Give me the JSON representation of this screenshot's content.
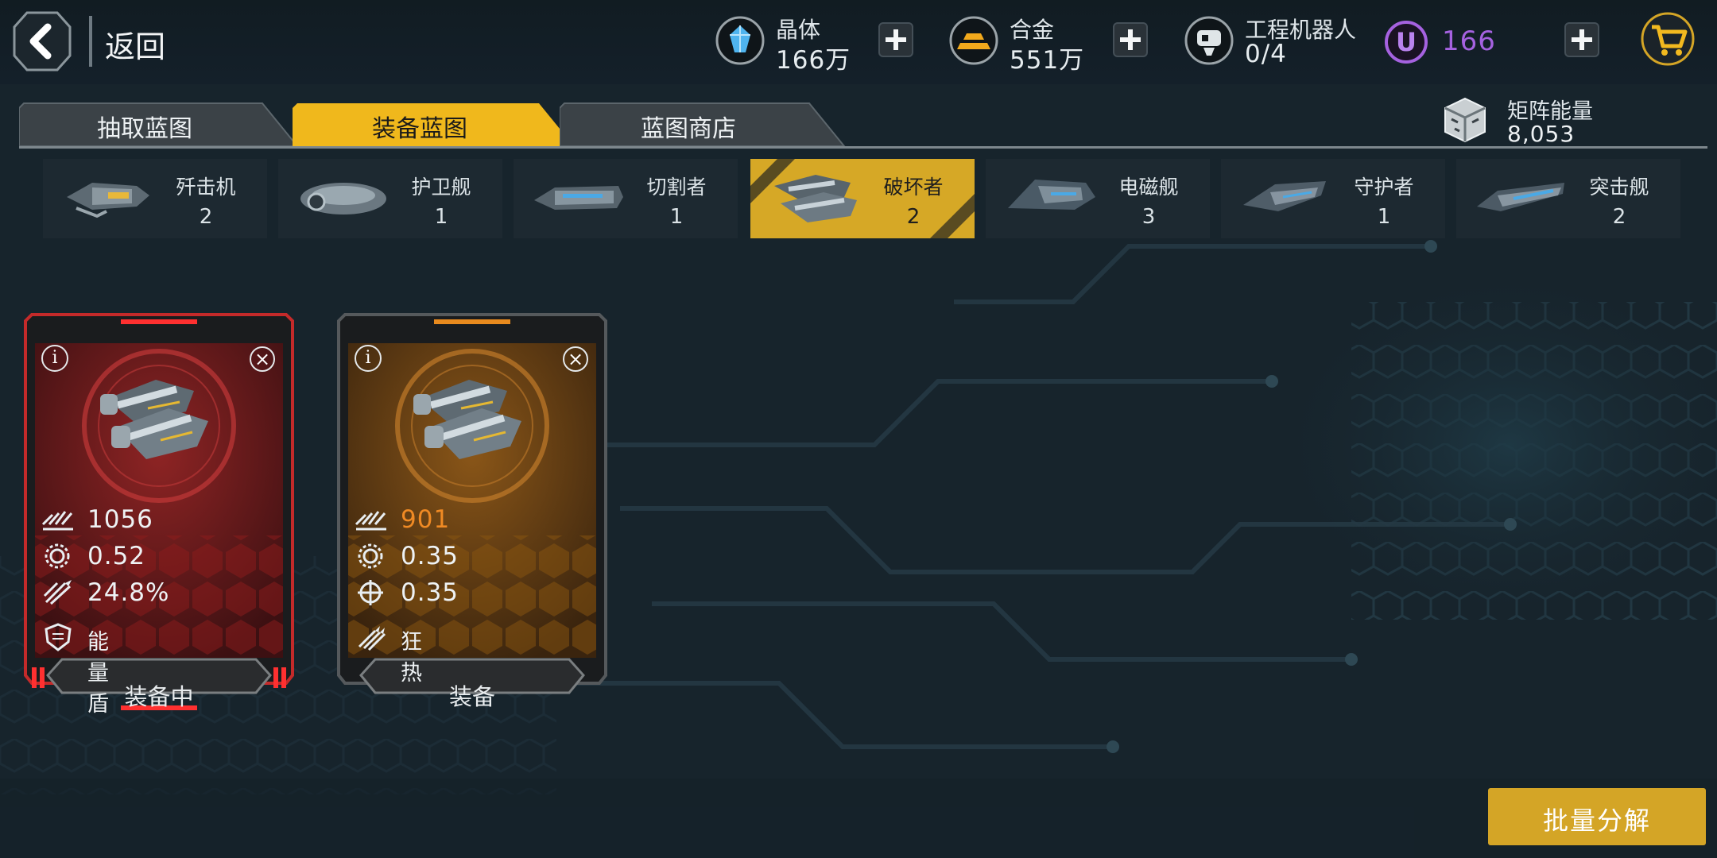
{
  "header": {
    "back_label": "返回",
    "resources": [
      {
        "name": "crystal",
        "label": "晶体",
        "value": "166万",
        "icon": "crystal-icon"
      },
      {
        "name": "alloy",
        "label": "合金",
        "value": "551万",
        "icon": "alloy-icon"
      },
      {
        "name": "robot",
        "label": "工程机器人",
        "value": "0/4",
        "icon": "robot-icon"
      },
      {
        "name": "u-currency",
        "value": "166",
        "icon": "u-coin-icon"
      }
    ],
    "u_coin_letter": "U"
  },
  "tabs": [
    {
      "label": "抽取蓝图",
      "active": false
    },
    {
      "label": "装备蓝图",
      "active": true
    },
    {
      "label": "蓝图商店",
      "active": false
    }
  ],
  "matrix": {
    "label": "矩阵能量",
    "value": "8,053"
  },
  "ships": [
    {
      "name": "歼击机",
      "count": "2",
      "active": false
    },
    {
      "name": "护卫舰",
      "count": "1",
      "active": false
    },
    {
      "name": "切割者",
      "count": "1",
      "active": false
    },
    {
      "name": "破坏者",
      "count": "2",
      "active": true
    },
    {
      "name": "电磁舰",
      "count": "3",
      "active": false
    },
    {
      "name": "守护者",
      "count": "1",
      "active": false
    },
    {
      "name": "突击舰",
      "count": "2",
      "active": false
    }
  ],
  "cards": [
    {
      "rarity": "red",
      "stats": [
        {
          "icon": "damage-icon",
          "value": "1056"
        },
        {
          "icon": "fire-rate-icon",
          "value": "0.52"
        },
        {
          "icon": "missile-icon",
          "value": "24.8%"
        }
      ],
      "skill": {
        "icon": "shield-icon",
        "label": "能量盾"
      },
      "button_label": "装备中"
    },
    {
      "rarity": "orange",
      "stats": [
        {
          "icon": "damage-icon",
          "value": "901"
        },
        {
          "icon": "fire-rate-icon",
          "value": "0.35"
        },
        {
          "icon": "target-icon",
          "value": "0.35"
        }
      ],
      "skill": {
        "icon": "frenzy-icon",
        "label": "狂热"
      },
      "button_label": "装备"
    }
  ],
  "batch_button": "批量分解",
  "colors": {
    "gold": "#d6a826",
    "red": "#c42a2a",
    "orange": "#e88a1e",
    "u_purple": "#a562e0",
    "orange_text": "#f08a24"
  }
}
